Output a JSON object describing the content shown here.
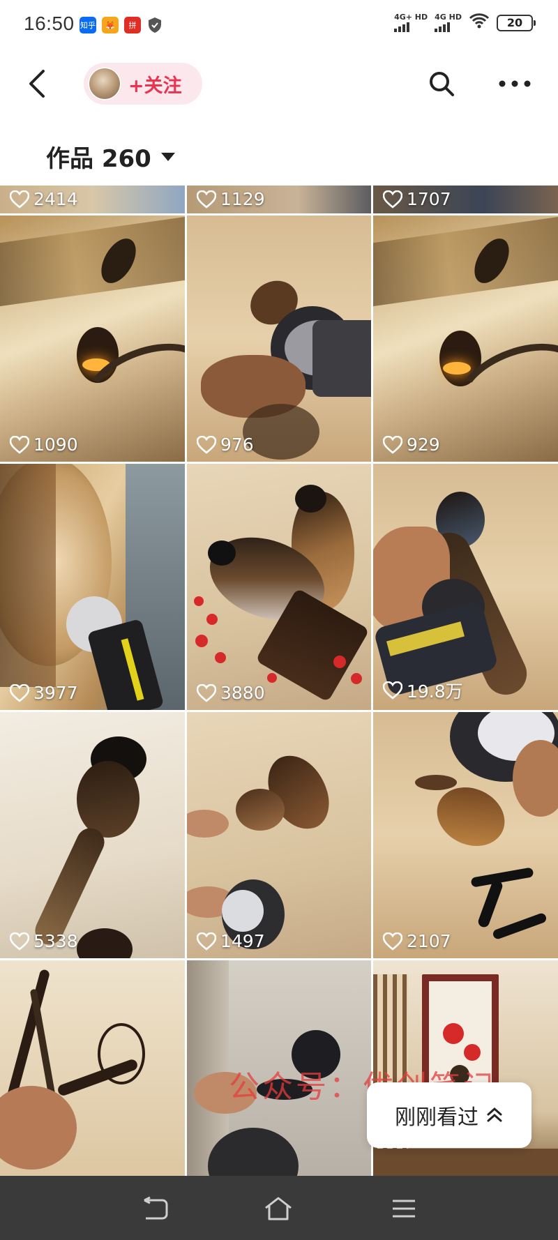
{
  "status_bar": {
    "time": "16:50",
    "app_icons": [
      {
        "name": "zhihu-icon",
        "glyph": "知乎"
      },
      {
        "name": "fox-app-icon",
        "glyph": "🦊"
      },
      {
        "name": "pinduoduo-icon",
        "glyph": "拼"
      },
      {
        "name": "shield-icon",
        "glyph": ""
      }
    ],
    "signal1_label": "4G+ HD",
    "signal2_label": "4G HD",
    "battery": "20"
  },
  "top_bar": {
    "follow_label": "+关注"
  },
  "works": {
    "label": "作品 260"
  },
  "grid": {
    "likes": [
      "2414",
      "1129",
      "1707",
      "1090",
      "976",
      "929",
      "3977",
      "3880",
      "19.8万",
      "5338",
      "1497",
      "2107"
    ]
  },
  "floating": {
    "recent_label": "刚刚看过"
  },
  "watermark": "公众号：优创笔记",
  "colors": {
    "accent": "#e9334f",
    "follow_bg": "#fbe7ec",
    "navbar_bg": "#3a3a3a"
  }
}
